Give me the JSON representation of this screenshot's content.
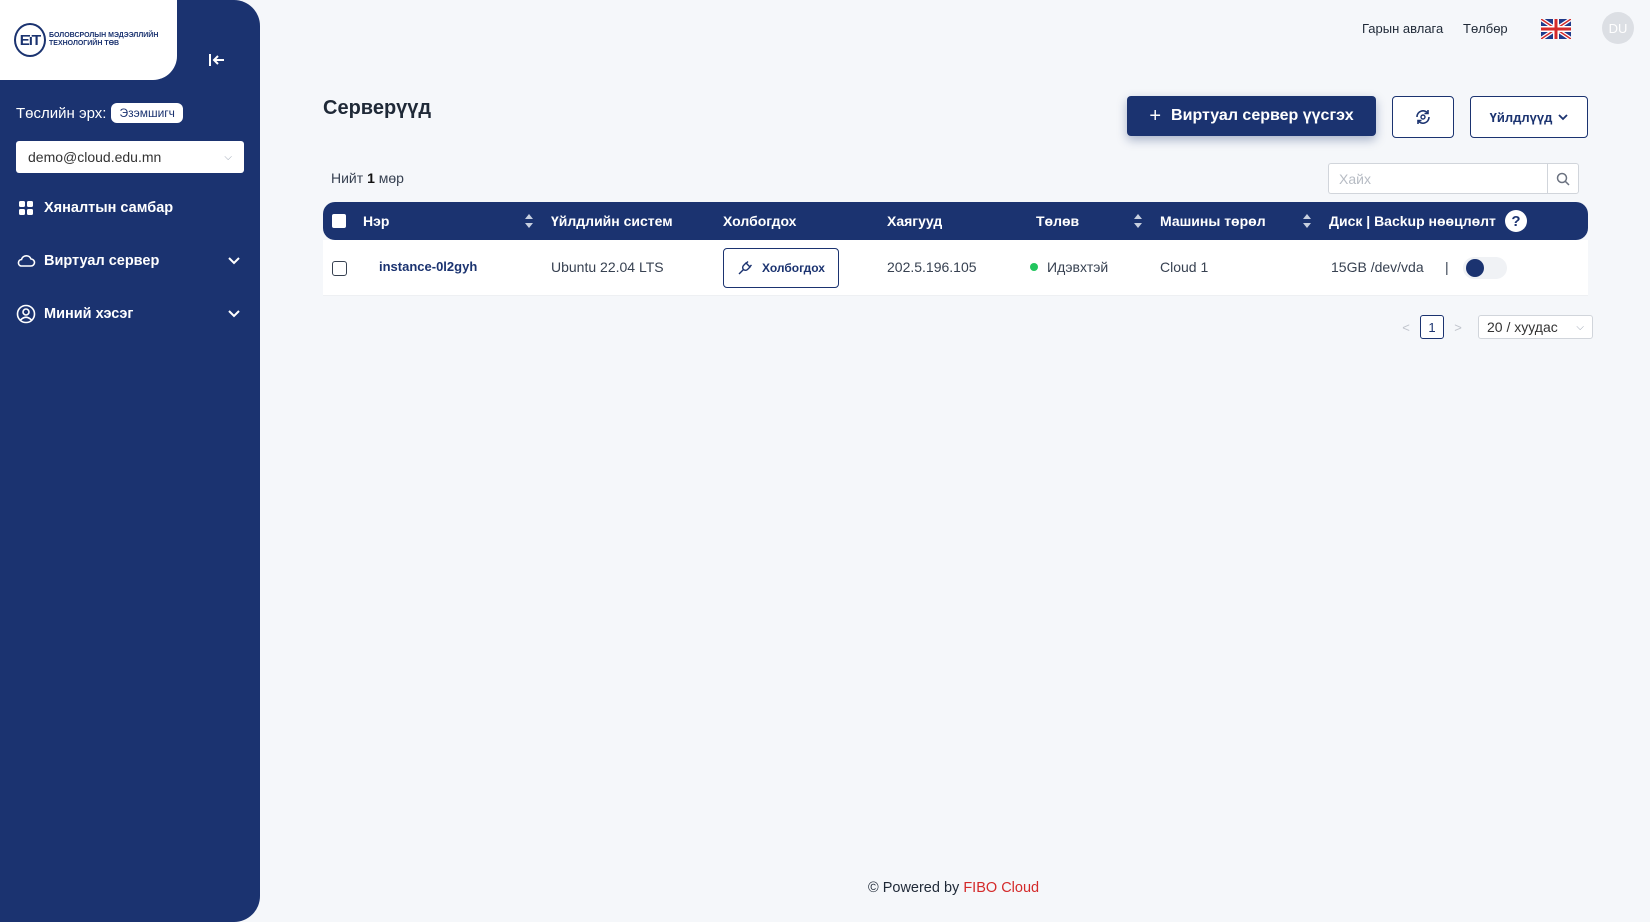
{
  "app": {
    "logo_mark": "ЕїТ",
    "logo_text": "БОЛОВСРОЛЫН МЭДЭЭЛЛИЙН ТЕХНОЛОГИЙН ТӨВ"
  },
  "sidebar": {
    "role_label": "Төслийн эрх:",
    "role_badge": "Эзэмшигч",
    "account": "demo@cloud.edu.mn",
    "items": [
      {
        "label": "Хяналтын самбар",
        "icon": "dashboard-grid-icon"
      },
      {
        "label": "Виртуал сервер",
        "icon": "cloud-icon"
      },
      {
        "label": "Миний хэсэг",
        "icon": "user-circle-icon"
      }
    ]
  },
  "header": {
    "guide_link": "Гарын авлага",
    "payment_link": "Төлбөр",
    "language_flag": "uk-flag-icon",
    "avatar_initials": "DU"
  },
  "main": {
    "title": "Серверүүд",
    "create_button": "Виртуал сервер үүсгэх",
    "actions_button": "Үйлдлүүд",
    "total_prefix": "Нийт",
    "total_count": "1",
    "total_suffix": "мөр",
    "search_placeholder": "Хайх"
  },
  "table": {
    "columns": [
      "Нэр",
      "Үйлдлийн систем",
      "Холбогдох",
      "Хаягууд",
      "Төлөв",
      "Машины төрөл",
      "Диск | Backup нөөцлөлт"
    ],
    "help_icon": "?",
    "rows": [
      {
        "name": "instance-0l2gyh",
        "os": "Ubuntu 22.04 LTS",
        "connect_label": "Холбогдох",
        "address": "202.5.196.105",
        "status": "Идэвхтэй",
        "status_color": "#22c55e",
        "machine_type": "Cloud 1",
        "disk": "15GB /dev/vda",
        "separator": "|",
        "backup_enabled": false
      }
    ]
  },
  "pagination": {
    "current_page": "1",
    "page_size": "20 / хуудас"
  },
  "footer": {
    "text": "© Powered by",
    "brand": "FIBO Cloud",
    "brand_color": "#d42a2a"
  },
  "colors": {
    "primary": "#1b3370",
    "background": "#f5f7fa"
  }
}
